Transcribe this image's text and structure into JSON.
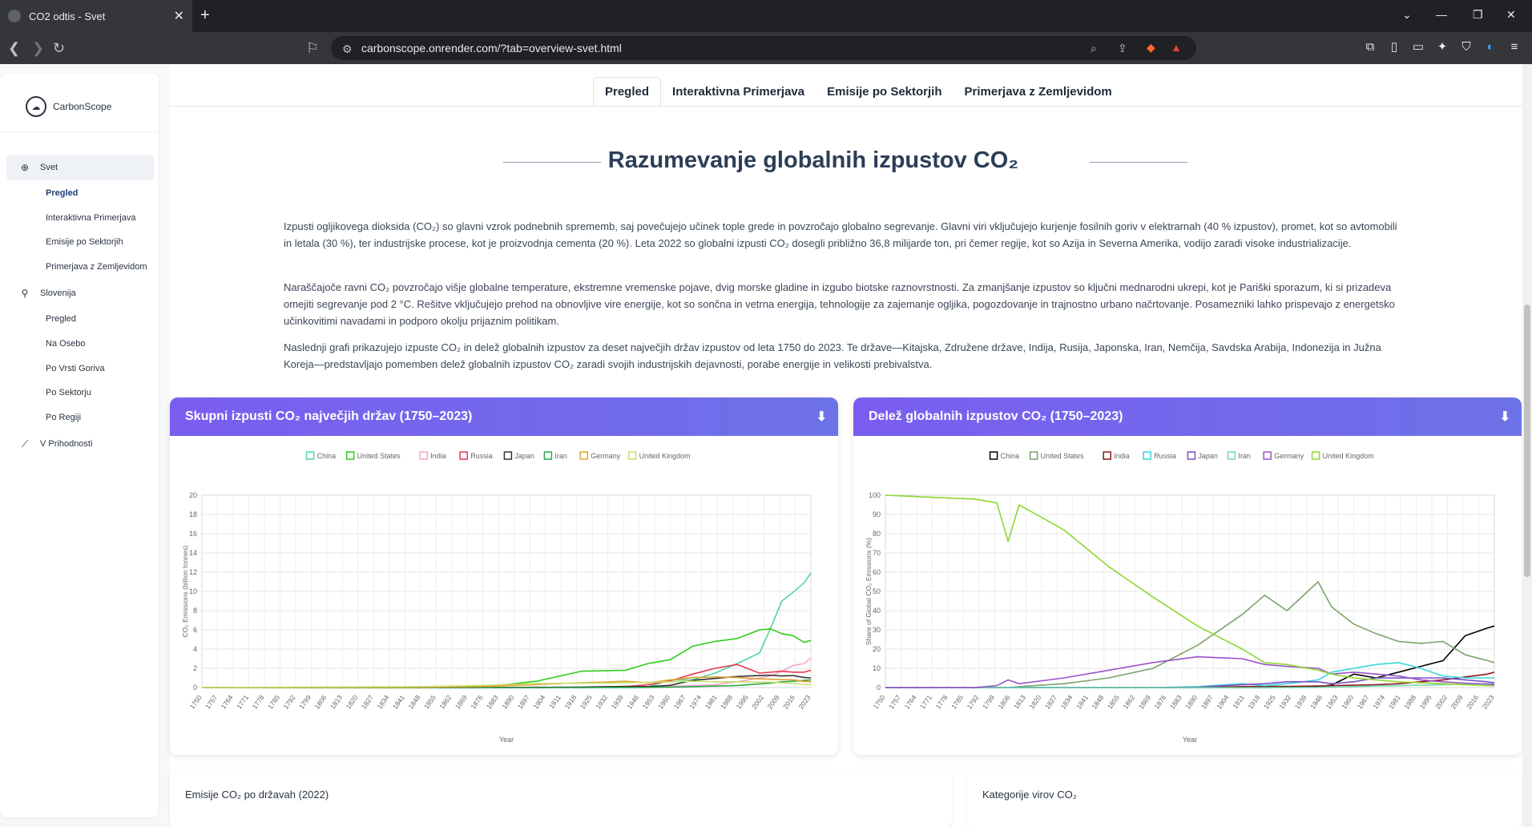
{
  "browser": {
    "tab_title": "CO2 odtis - Svet",
    "url": "carbonscope.onrender.com/?tab=overview-svet.html"
  },
  "sidebar": {
    "brand": "CarbonScope",
    "sections": [
      {
        "label": "Svet",
        "icon": "globe-icon"
      },
      {
        "label": "Slovenija",
        "icon": "map-pin-icon"
      },
      {
        "label": "V Prihodnosti",
        "icon": "trend-chart-icon"
      }
    ],
    "svet_items": [
      "Pregled",
      "Interaktivna Primerjava",
      "Emisije po Sektorjih",
      "Primerjava z Zemljevidom"
    ],
    "slovenija_items": [
      "Pregled",
      "Na Osebo",
      "Po Vrsti Goriva",
      "Po Sektorju",
      "Po Regiji"
    ]
  },
  "tabs": [
    "Pregled",
    "Interaktivna Primerjava",
    "Emisije po Sektorjih",
    "Primerjava z Zemljevidom"
  ],
  "main": {
    "title": "Razumevanje globalnih izpustov CO₂",
    "paragraphs": [
      "Izpusti ogljikovega dioksida (CO₂) so glavni vzrok podnebnih sprememb, saj povečujejo učinek tople grede in povzročajo globalno segrevanje. Glavni viri vključujejo kurjenje fosilnih goriv v elektrarnah (40 % izpustov), promet, kot so avtomobili in letala (30 %), ter industrijske procese, kot je proizvodnja cementa (20 %). Leta 2022 so globalni izpusti CO₂ dosegli približno 36,8 milijarde ton, pri čemer regije, kot so Azija in Severna Amerika, vodijo zaradi visoke industrializacije.",
      "Naraščajoče ravni CO₂ povzročajo višje globalne temperature, ekstremne vremenske pojave, dvig morske gladine in izgubo biotske raznovrstnosti. Za zmanjšanje izpustov so ključni mednarodni ukrepi, kot je Pariški sporazum, ki si prizadeva omejiti segrevanje pod 2 °C. Rešitve vključujejo prehod na obnovljive vire energije, kot so sončna in vetrna energija, tehnologije za zajemanje ogljika, pogozdovanje in trajnostno urbano načrtovanje. Posamezniki lahko prispevajo z energetsko učinkovitimi navadami in podporo okolju prijaznim politikam.",
      "Naslednji grafi prikazujejo izpuste CO₂ in delež globalnih izpustov za deset največjih držav izpustov od leta 1750 do 2023. Te države—Kitajska, Združene države, Indija, Rusija, Japonska, Iran, Nemčija, Savdska Arabija, Indonezija in Južna Koreja—predstavljajo pomemben delež globalnih izpustov CO₂ zaradi svojih industrijskih dejavnosti, porabe energije in velikosti prebivalstva."
    ]
  },
  "chart_data": [
    {
      "type": "line",
      "title": "Skupni izpusti CO₂ največjih držav (1750–2023)",
      "xlabel": "Year",
      "ylabel": "CO₂ Emissions (billion tonnes)",
      "ylim": [
        0,
        20
      ],
      "yticks": [
        0,
        2,
        4,
        6,
        8,
        10,
        12,
        14,
        16,
        18,
        20
      ],
      "xticks": [
        "1750",
        "1757",
        "1764",
        "1771",
        "1778",
        "1785",
        "1792",
        "1799",
        "1806",
        "1813",
        "1820",
        "1827",
        "1834",
        "1841",
        "1848",
        "1855",
        "1862",
        "1869",
        "1876",
        "1883",
        "1890",
        "1897",
        "1904",
        "1911",
        "1918",
        "1925",
        "1932",
        "1939",
        "1946",
        "1953",
        "1960",
        "1967",
        "1974",
        "1981",
        "1988",
        "1995",
        "2002",
        "2009",
        "2016",
        "2023"
      ],
      "legend_position": "top-center",
      "grid": true,
      "x": [
        1750,
        1850,
        1880,
        1900,
        1920,
        1940,
        1950,
        1960,
        1970,
        1980,
        1990,
        2000,
        2005,
        2010,
        2015,
        2020,
        2023
      ],
      "series": [
        {
          "name": "China",
          "color": "#4fd69c",
          "values": [
            0,
            0,
            0,
            0,
            0.01,
            0.04,
            0.08,
            0.8,
            0.8,
            1.5,
            2.5,
            3.6,
            6.2,
            9.0,
            9.9,
            10.9,
            11.9
          ]
        },
        {
          "name": "United States",
          "color": "#2ecc1a",
          "values": [
            0,
            0.01,
            0.15,
            0.66,
            1.7,
            1.8,
            2.5,
            2.9,
            4.3,
            4.8,
            5.1,
            6.0,
            6.1,
            5.6,
            5.4,
            4.7,
            4.9
          ]
        },
        {
          "name": "India",
          "color": "#f3a6c7",
          "values": [
            0,
            0,
            0,
            0,
            0.02,
            0.04,
            0.06,
            0.12,
            0.2,
            0.3,
            0.6,
            1.0,
            1.2,
            1.7,
            2.3,
            2.5,
            3.1
          ]
        },
        {
          "name": "Russia",
          "color": "#e63950",
          "values": [
            0,
            0,
            0,
            0.03,
            0.02,
            0.1,
            0.3,
            0.7,
            1.4,
            2.0,
            2.4,
            1.5,
            1.6,
            1.7,
            1.6,
            1.6,
            1.8
          ]
        },
        {
          "name": "Japan",
          "color": "#333333",
          "values": [
            0,
            0,
            0,
            0.01,
            0.05,
            0.12,
            0.1,
            0.23,
            0.76,
            0.95,
            1.15,
            1.26,
            1.29,
            1.2,
            1.25,
            1.05,
            1.0
          ]
        },
        {
          "name": "Iran",
          "color": "#2aa64b",
          "values": [
            0,
            0,
            0,
            0,
            0,
            0.01,
            0.02,
            0.04,
            0.1,
            0.15,
            0.22,
            0.38,
            0.47,
            0.6,
            0.65,
            0.74,
            0.8
          ]
        },
        {
          "name": "Germany",
          "color": "#e0a030",
          "values": [
            0,
            0.03,
            0.13,
            0.32,
            0.5,
            0.65,
            0.5,
            0.8,
            1.03,
            1.1,
            1.05,
            0.9,
            0.87,
            0.83,
            0.8,
            0.64,
            0.6
          ]
        },
        {
          "name": "United Kingdom",
          "color": "#c8e06a",
          "values": [
            0,
            0.1,
            0.25,
            0.42,
            0.45,
            0.5,
            0.55,
            0.6,
            0.66,
            0.6,
            0.6,
            0.56,
            0.56,
            0.5,
            0.42,
            0.33,
            0.3
          ]
        }
      ]
    },
    {
      "type": "line",
      "title": "Delež globalnih izpustov CO₂ (1750–2023)",
      "xlabel": "Year",
      "ylabel": "Share of Global CO₂ Emissions (%)",
      "ylim": [
        0,
        100
      ],
      "yticks": [
        0,
        10,
        20,
        30,
        40,
        50,
        60,
        70,
        80,
        90,
        100
      ],
      "xticks": [
        "1750",
        "1757",
        "1764",
        "1771",
        "1778",
        "1785",
        "1792",
        "1799",
        "1806",
        "1813",
        "1820",
        "1827",
        "1834",
        "1841",
        "1848",
        "1855",
        "1862",
        "1869",
        "1876",
        "1883",
        "1890",
        "1897",
        "1904",
        "1911",
        "1918",
        "1925",
        "1932",
        "1939",
        "1946",
        "1953",
        "1960",
        "1967",
        "1974",
        "1981",
        "1988",
        "1995",
        "2002",
        "2009",
        "2016",
        "2023"
      ],
      "legend_position": "top-center",
      "grid": true,
      "x": [
        1750,
        1790,
        1800,
        1805,
        1810,
        1830,
        1850,
        1870,
        1890,
        1910,
        1920,
        1930,
        1944,
        1950,
        1960,
        1970,
        1980,
        1990,
        2000,
        2010,
        2020,
        2023
      ],
      "series": [
        {
          "name": "China",
          "color": "#000000",
          "values": [
            0,
            0,
            0,
            0,
            0,
            0,
            0,
            0,
            0,
            0,
            0,
            0.2,
            0.5,
            1.3,
            7,
            5,
            8,
            11,
            14,
            27,
            31,
            32
          ]
        },
        {
          "name": "United States",
          "color": "#7aa36a",
          "values": [
            0,
            0,
            0,
            0,
            0.5,
            2,
            5,
            10,
            22,
            38,
            48,
            40,
            55,
            42,
            33,
            28,
            24,
            23,
            24,
            17,
            14,
            13
          ]
        },
        {
          "name": "India",
          "color": "#8b1a1a",
          "values": [
            0,
            0,
            0,
            0,
            0,
            0,
            0,
            0,
            0.1,
            0.5,
            0.6,
            0.6,
            0.8,
            1,
            1.2,
            1.5,
            2,
            3,
            4,
            5.5,
            7,
            8
          ]
        },
        {
          "name": "Russia",
          "color": "#38d8dc",
          "values": [
            0,
            0,
            0,
            0,
            0,
            0,
            0,
            0,
            0.5,
            2,
            1,
            2,
            4,
            8,
            10,
            12,
            13,
            10,
            6,
            5,
            5,
            5
          ]
        },
        {
          "name": "Japan",
          "color": "#7b4fc4",
          "values": [
            0,
            0,
            0,
            0,
            0,
            0,
            0,
            0,
            0.2,
            1.5,
            2,
            3,
            3,
            2,
            3,
            5,
            5,
            5,
            5,
            4,
            3,
            2.5
          ]
        },
        {
          "name": "Iran",
          "color": "#6fd7b0",
          "values": [
            0,
            0,
            0,
            0,
            0,
            0,
            0,
            0,
            0,
            0,
            0,
            0,
            0.1,
            0.3,
            0.5,
            0.8,
            1,
            1.2,
            1.5,
            2,
            2,
            2
          ]
        },
        {
          "name": "Germany",
          "color": "#9a52c9",
          "values": [
            0,
            0,
            1,
            4,
            2,
            5,
            9,
            13,
            16,
            15,
            12,
            11,
            10,
            7,
            8,
            7,
            6,
            4,
            3,
            2.3,
            1.8,
            1.6
          ]
        },
        {
          "name": "United Kingdom",
          "color": "#8fd62e",
          "values": [
            100,
            98,
            96,
            76,
            95,
            82,
            63,
            47,
            32,
            20,
            13,
            12,
            9,
            7,
            5,
            4,
            3,
            2.5,
            2,
            1.5,
            1,
            0.9
          ]
        }
      ]
    }
  ],
  "bottom_cards": [
    "Emisije CO₂ po državah (2022)",
    "Kategorije virov CO₂"
  ]
}
